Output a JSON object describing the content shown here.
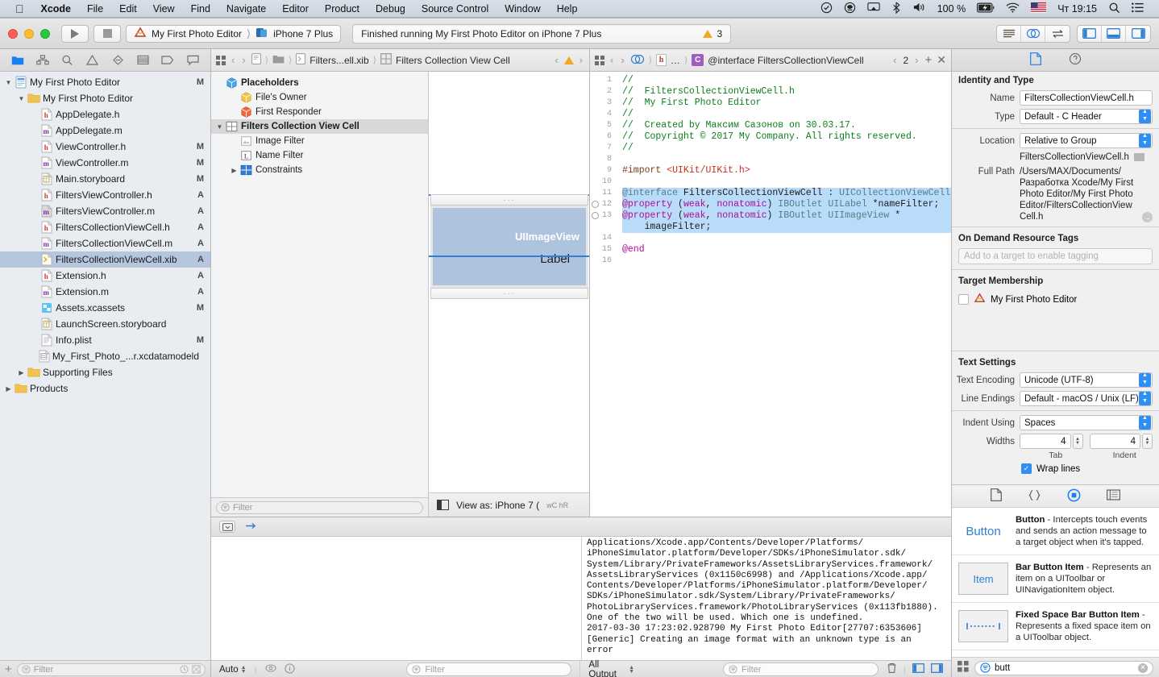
{
  "menubar": {
    "apple": "",
    "items": [
      "Xcode",
      "File",
      "Edit",
      "View",
      "Find",
      "Navigate",
      "Editor",
      "Product",
      "Debug",
      "Source Control",
      "Window",
      "Help"
    ],
    "battery": "100 %",
    "clock": "Чт 19:15"
  },
  "toolbar": {
    "scheme_project": "My First Photo Editor",
    "scheme_device": "iPhone 7 Plus",
    "status": "Finished running My First Photo Editor on iPhone 7 Plus",
    "warning_count": "3"
  },
  "navigator": {
    "tabs": [
      "folder-icon",
      "hierarchy-icon",
      "search-icon",
      "warning-icon",
      "breakpoint-icon",
      "test-icon",
      "tag-icon",
      "report-icon"
    ],
    "items": [
      {
        "label": "My First Photo Editor",
        "badge": "M",
        "depth": 0,
        "icon": "project",
        "twisty": "down"
      },
      {
        "label": "My First Photo Editor",
        "badge": "",
        "depth": 1,
        "icon": "folder",
        "twisty": "down"
      },
      {
        "label": "AppDelegate.h",
        "badge": "",
        "depth": 2,
        "icon": "h"
      },
      {
        "label": "AppDelegate.m",
        "badge": "",
        "depth": 2,
        "icon": "m"
      },
      {
        "label": "ViewController.h",
        "badge": "M",
        "depth": 2,
        "icon": "h"
      },
      {
        "label": "ViewController.m",
        "badge": "M",
        "depth": 2,
        "icon": "m"
      },
      {
        "label": "Main.storyboard",
        "badge": "M",
        "depth": 2,
        "icon": "storyboard"
      },
      {
        "label": "FiltersViewController.h",
        "badge": "A",
        "depth": 2,
        "icon": "h"
      },
      {
        "label": "FiltersViewController.m",
        "badge": "A",
        "depth": 2,
        "icon": "mgray"
      },
      {
        "label": "FiltersCollectionViewCell.h",
        "badge": "A",
        "depth": 2,
        "icon": "h"
      },
      {
        "label": "FiltersCollectionViewCell.m",
        "badge": "A",
        "depth": 2,
        "icon": "m"
      },
      {
        "label": "FiltersCollectionViewCell.xib",
        "badge": "A",
        "depth": 2,
        "icon": "xib",
        "selected": true
      },
      {
        "label": "Extension.h",
        "badge": "A",
        "depth": 2,
        "icon": "h"
      },
      {
        "label": "Extension.m",
        "badge": "A",
        "depth": 2,
        "icon": "m"
      },
      {
        "label": "Assets.xcassets",
        "badge": "M",
        "depth": 2,
        "icon": "assets"
      },
      {
        "label": "LaunchScreen.storyboard",
        "badge": "",
        "depth": 2,
        "icon": "storyboard"
      },
      {
        "label": "Info.plist",
        "badge": "M",
        "depth": 2,
        "icon": "plist"
      },
      {
        "label": "My_First_Photo_...r.xcdatamodeld",
        "badge": "",
        "depth": 2,
        "icon": "datamodel"
      },
      {
        "label": "Supporting Files",
        "badge": "",
        "depth": 1,
        "icon": "folder",
        "twisty": "right"
      },
      {
        "label": "Products",
        "badge": "",
        "depth": 0,
        "icon": "folder",
        "twisty": "right"
      }
    ],
    "filter_placeholder": "Filter"
  },
  "ib_editor": {
    "jumpbar": {
      "file": "Filters...ell.xib",
      "scene": "Filters Collection View Cell"
    },
    "outline": [
      {
        "label": "Placeholders",
        "depth": 0,
        "icon": "placeholder",
        "bold": true
      },
      {
        "label": "File's Owner",
        "depth": 1,
        "icon": "owner"
      },
      {
        "label": "First Responder",
        "depth": 1,
        "icon": "responder"
      },
      {
        "label": "Filters Collection View Cell",
        "depth": 0,
        "icon": "cell",
        "selected": true,
        "twisty": "down"
      },
      {
        "label": "Image Filter",
        "depth": 1,
        "icon": "imageview"
      },
      {
        "label": "Name Filter",
        "depth": 1,
        "icon": "label"
      },
      {
        "label": "Constraints",
        "depth": 1,
        "icon": "constraints",
        "twisty": "right"
      }
    ],
    "filter_placeholder": "Filter",
    "canvas": {
      "imageview_label": "UIImageView",
      "label_text": "Label"
    },
    "view_as": "View as: iPhone 7 (",
    "view_as_traits": "wC  hR"
  },
  "code_editor": {
    "jumpbar": {
      "ellipsis": "…",
      "symbol": "@interface FiltersCollectionViewCell",
      "counter": "2"
    },
    "lines": [
      {
        "n": "1",
        "segments": [
          {
            "t": "//",
            "c": "c-com"
          }
        ]
      },
      {
        "n": "2",
        "segments": [
          {
            "t": "//  FiltersCollectionViewCell.h",
            "c": "c-com"
          }
        ]
      },
      {
        "n": "3",
        "segments": [
          {
            "t": "//  My First Photo Editor",
            "c": "c-com"
          }
        ]
      },
      {
        "n": "4",
        "segments": [
          {
            "t": "//",
            "c": "c-com"
          }
        ]
      },
      {
        "n": "5",
        "segments": [
          {
            "t": "//  Created by Максим Сазонов on 30.03.17.",
            "c": "c-com"
          }
        ]
      },
      {
        "n": "6",
        "segments": [
          {
            "t": "//  Copyright © 2017 My Company. All rights reserved.",
            "c": "c-com"
          }
        ]
      },
      {
        "n": "7",
        "segments": [
          {
            "t": "//",
            "c": "c-com"
          }
        ]
      },
      {
        "n": "8",
        "segments": [
          {
            "t": "",
            "c": "c-plain"
          }
        ]
      },
      {
        "n": "9",
        "segments": [
          {
            "t": "#import ",
            "c": "c-pre"
          },
          {
            "t": "<UIKit/UIKit.h>",
            "c": "c-str"
          }
        ]
      },
      {
        "n": "10",
        "segments": [
          {
            "t": "",
            "c": "c-plain"
          }
        ]
      },
      {
        "n": "11",
        "hl": true,
        "segments": [
          {
            "t": "@interface",
            "c": "c-type"
          },
          {
            "t": " FiltersCollectionViewCell : ",
            "c": "c-plain"
          },
          {
            "t": "UICollectionViewCell",
            "c": "c-type"
          }
        ]
      },
      {
        "n": "12",
        "bp": true,
        "hl": true,
        "segments": [
          {
            "t": "@property",
            "c": "c-kw"
          },
          {
            "t": " (",
            "c": "c-plain"
          },
          {
            "t": "weak",
            "c": "c-kw"
          },
          {
            "t": ", ",
            "c": "c-plain"
          },
          {
            "t": "nonatomic",
            "c": "c-kw"
          },
          {
            "t": ") ",
            "c": "c-plain"
          },
          {
            "t": "IBOutlet",
            "c": "c-type"
          },
          {
            "t": " ",
            "c": "c-plain"
          },
          {
            "t": "UILabel",
            "c": "c-type"
          },
          {
            "t": " *nameFilter;",
            "c": "c-plain"
          }
        ]
      },
      {
        "n": "13",
        "bp": true,
        "hl": true,
        "segments": [
          {
            "t": "@property",
            "c": "c-kw"
          },
          {
            "t": " (",
            "c": "c-plain"
          },
          {
            "t": "weak",
            "c": "c-kw"
          },
          {
            "t": ", ",
            "c": "c-plain"
          },
          {
            "t": "nonatomic",
            "c": "c-kw"
          },
          {
            "t": ") ",
            "c": "c-plain"
          },
          {
            "t": "IBOutlet",
            "c": "c-type"
          },
          {
            "t": " ",
            "c": "c-plain"
          },
          {
            "t": "UIImageView",
            "c": "c-type"
          },
          {
            "t": " *",
            "c": "c-plain"
          }
        ]
      },
      {
        "n": "",
        "hl": true,
        "segments": [
          {
            "t": "    imageFilter;",
            "c": "c-plain"
          }
        ]
      },
      {
        "n": "14",
        "segments": [
          {
            "t": "",
            "c": "c-plain"
          }
        ]
      },
      {
        "n": "15",
        "segments": [
          {
            "t": "@end",
            "c": "c-kw"
          }
        ]
      },
      {
        "n": "16",
        "segments": [
          {
            "t": "",
            "c": "c-plain"
          }
        ]
      }
    ]
  },
  "debug": {
    "console_text": "Applications/Xcode.app/Contents/Developer/Platforms/\niPhoneSimulator.platform/Developer/SDKs/iPhoneSimulator.sdk/\nSystem/Library/PrivateFrameworks/AssetsLibraryServices.framework/\nAssetsLibraryServices (0x1150c6998) and /Applications/Xcode.app/\nContents/Developer/Platforms/iPhoneSimulator.platform/Developer/\nSDKs/iPhoneSimulator.sdk/System/Library/PrivateFrameworks/\nPhotoLibraryServices.framework/PhotoLibraryServices (0x113fb1880).\nOne of the two will be used. Which one is undefined.\n2017-03-30 17:23:02.928790 My First Photo Editor[27707:6353606]\n[Generic] Creating an image format with an unknown type is an\nerror",
    "scope_left": "Auto",
    "scope_right": "All Output",
    "filter_placeholder": "Filter"
  },
  "inspector": {
    "tabs": [
      "file-inspector-icon",
      "quick-help-icon",
      "identity-inspector-icon",
      "attributes-inspector-icon",
      "size-inspector-icon",
      "connections-inspector-icon"
    ],
    "identity_section": "Identity and Type",
    "name_label": "Name",
    "name_value": "FiltersCollectionViewCell.h",
    "type_label": "Type",
    "type_value": "Default - C Header",
    "location_label": "Location",
    "location_value": "Relative to Group",
    "location_file": "FiltersCollectionViewCell.h",
    "fullpath_label": "Full Path",
    "fullpath_value": "/Users/MAX/Documents/Разработка Xcode/My First Photo Editor/My First Photo Editor/FiltersCollectionViewCell.h",
    "odrt_section": "On Demand Resource Tags",
    "odrt_placeholder": "Add to a target to enable tagging",
    "target_section": "Target Membership",
    "target_item": "My First Photo Editor",
    "text_section": "Text Settings",
    "encoding_label": "Text Encoding",
    "encoding_value": "Unicode (UTF-8)",
    "endings_label": "Line Endings",
    "endings_value": "Default - macOS / Unix (LF)",
    "indent_label": "Indent Using",
    "indent_value": "Spaces",
    "widths_label": "Widths",
    "tab_width": "4",
    "indent_width": "4",
    "tab_sublabel": "Tab",
    "indent_sublabel": "Indent",
    "wrap_label": "Wrap lines"
  },
  "library": {
    "tabs": [
      "file-template-icon",
      "code-snippet-icon",
      "object-library-icon",
      "media-library-icon"
    ],
    "items": [
      {
        "icon_text": "Button",
        "boxed": false,
        "title": "Button",
        "desc": " - Intercepts touch events and sends an action message to a target object when it's tapped."
      },
      {
        "icon_text": "Item",
        "boxed": true,
        "title": "Bar Button Item",
        "desc": " - Represents an item on a UIToolbar or UINavigationItem object."
      },
      {
        "icon_text": "dots",
        "boxed": true,
        "title": "Fixed Space Bar Button Item",
        "desc": " - Represents a fixed space item on a UIToolbar object."
      }
    ],
    "search_value": "butt"
  }
}
